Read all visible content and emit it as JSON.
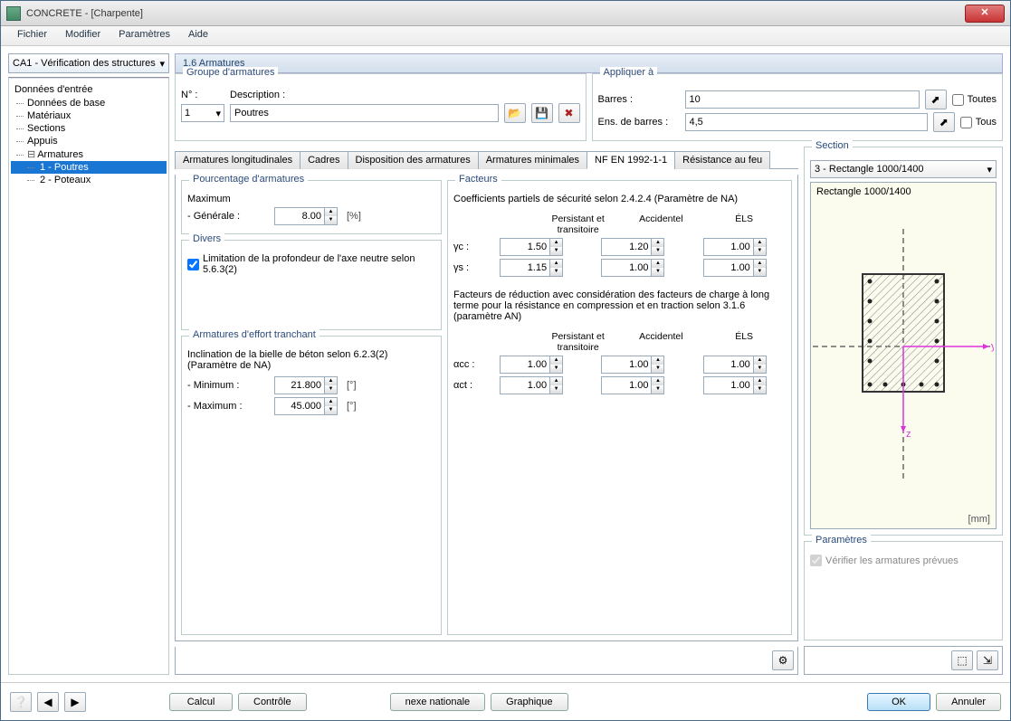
{
  "window": {
    "title": "CONCRETE - [Charpente]"
  },
  "menu": [
    "Fichier",
    "Modifier",
    "Paramètres",
    "Aide"
  ],
  "selector": "CA1 - Vérification des structures",
  "tree": {
    "root": "Données d'entrée",
    "items": [
      "Données de base",
      "Matériaux",
      "Sections",
      "Appuis",
      "Armatures"
    ],
    "armatures": [
      "1 - Poutres",
      "2 - Poteaux"
    ]
  },
  "page_title": "1.6 Armatures",
  "group": {
    "title": "Groupe d'armatures",
    "no_label": "N° :",
    "desc_label": "Description :",
    "no_value": "1",
    "desc_value": "Poutres"
  },
  "apply": {
    "title": "Appliquer à",
    "bars_label": "Barres :",
    "bars_value": "10",
    "sets_label": "Ens. de barres :",
    "sets_value": "4,5",
    "all1": "Toutes",
    "all2": "Tous"
  },
  "tabs": [
    "Armatures longitudinales",
    "Cadres",
    "Disposition des armatures",
    "Armatures minimales",
    "NF EN 1992-1-1",
    "Résistance au feu"
  ],
  "pct": {
    "title": "Pourcentage d'armatures",
    "max_label": "Maximum",
    "gen_label": "- Générale :",
    "gen_value": "8.00",
    "gen_unit": "[%]"
  },
  "divers": {
    "title": "Divers",
    "chk_label": "Limitation de la profondeur de l'axe neutre selon 5.6.3(2)"
  },
  "shear": {
    "title": "Armatures d'effort tranchant",
    "desc": "Inclination de la bielle de béton selon 6.2.3(2) (Paramètre de NA)",
    "min_label": "- Minimum :",
    "min_value": "21.800",
    "max_label": "- Maximum :",
    "max_value": "45.000",
    "unit": "[°]"
  },
  "factors": {
    "title": "Facteurs",
    "desc1": "Coefficients partiels de sécurité selon 2.4.2.4 (Paramètre de NA)",
    "cols": [
      "Persistant et transitoire",
      "Accidentel",
      "ÉLS"
    ],
    "gamma_c": "γc :",
    "gamma_s": "γs :",
    "gc_vals": [
      "1.50",
      "1.20",
      "1.00"
    ],
    "gs_vals": [
      "1.15",
      "1.00",
      "1.00"
    ],
    "desc2": "Facteurs de réduction avec considération des facteurs de charge à long terme pour la résistance en compression et en traction selon 3.1.6 (paramètre AN)",
    "alpha_cc": "αcc :",
    "alpha_ct": "αct :",
    "acc_vals": [
      "1.00",
      "1.00",
      "1.00"
    ],
    "act_vals": [
      "1.00",
      "1.00",
      "1.00"
    ]
  },
  "section": {
    "title": "Section",
    "selected": "3 - Rectangle 1000/1400",
    "label": "Rectangle 1000/1400",
    "mm": "[mm]"
  },
  "params": {
    "title": "Paramètres",
    "chk": "Vérifier les armatures prévues"
  },
  "buttons": {
    "calcul": "Calcul",
    "controle": "Contrôle",
    "nexe": "nexe nationale",
    "graph": "Graphique",
    "ok": "OK",
    "cancel": "Annuler"
  }
}
